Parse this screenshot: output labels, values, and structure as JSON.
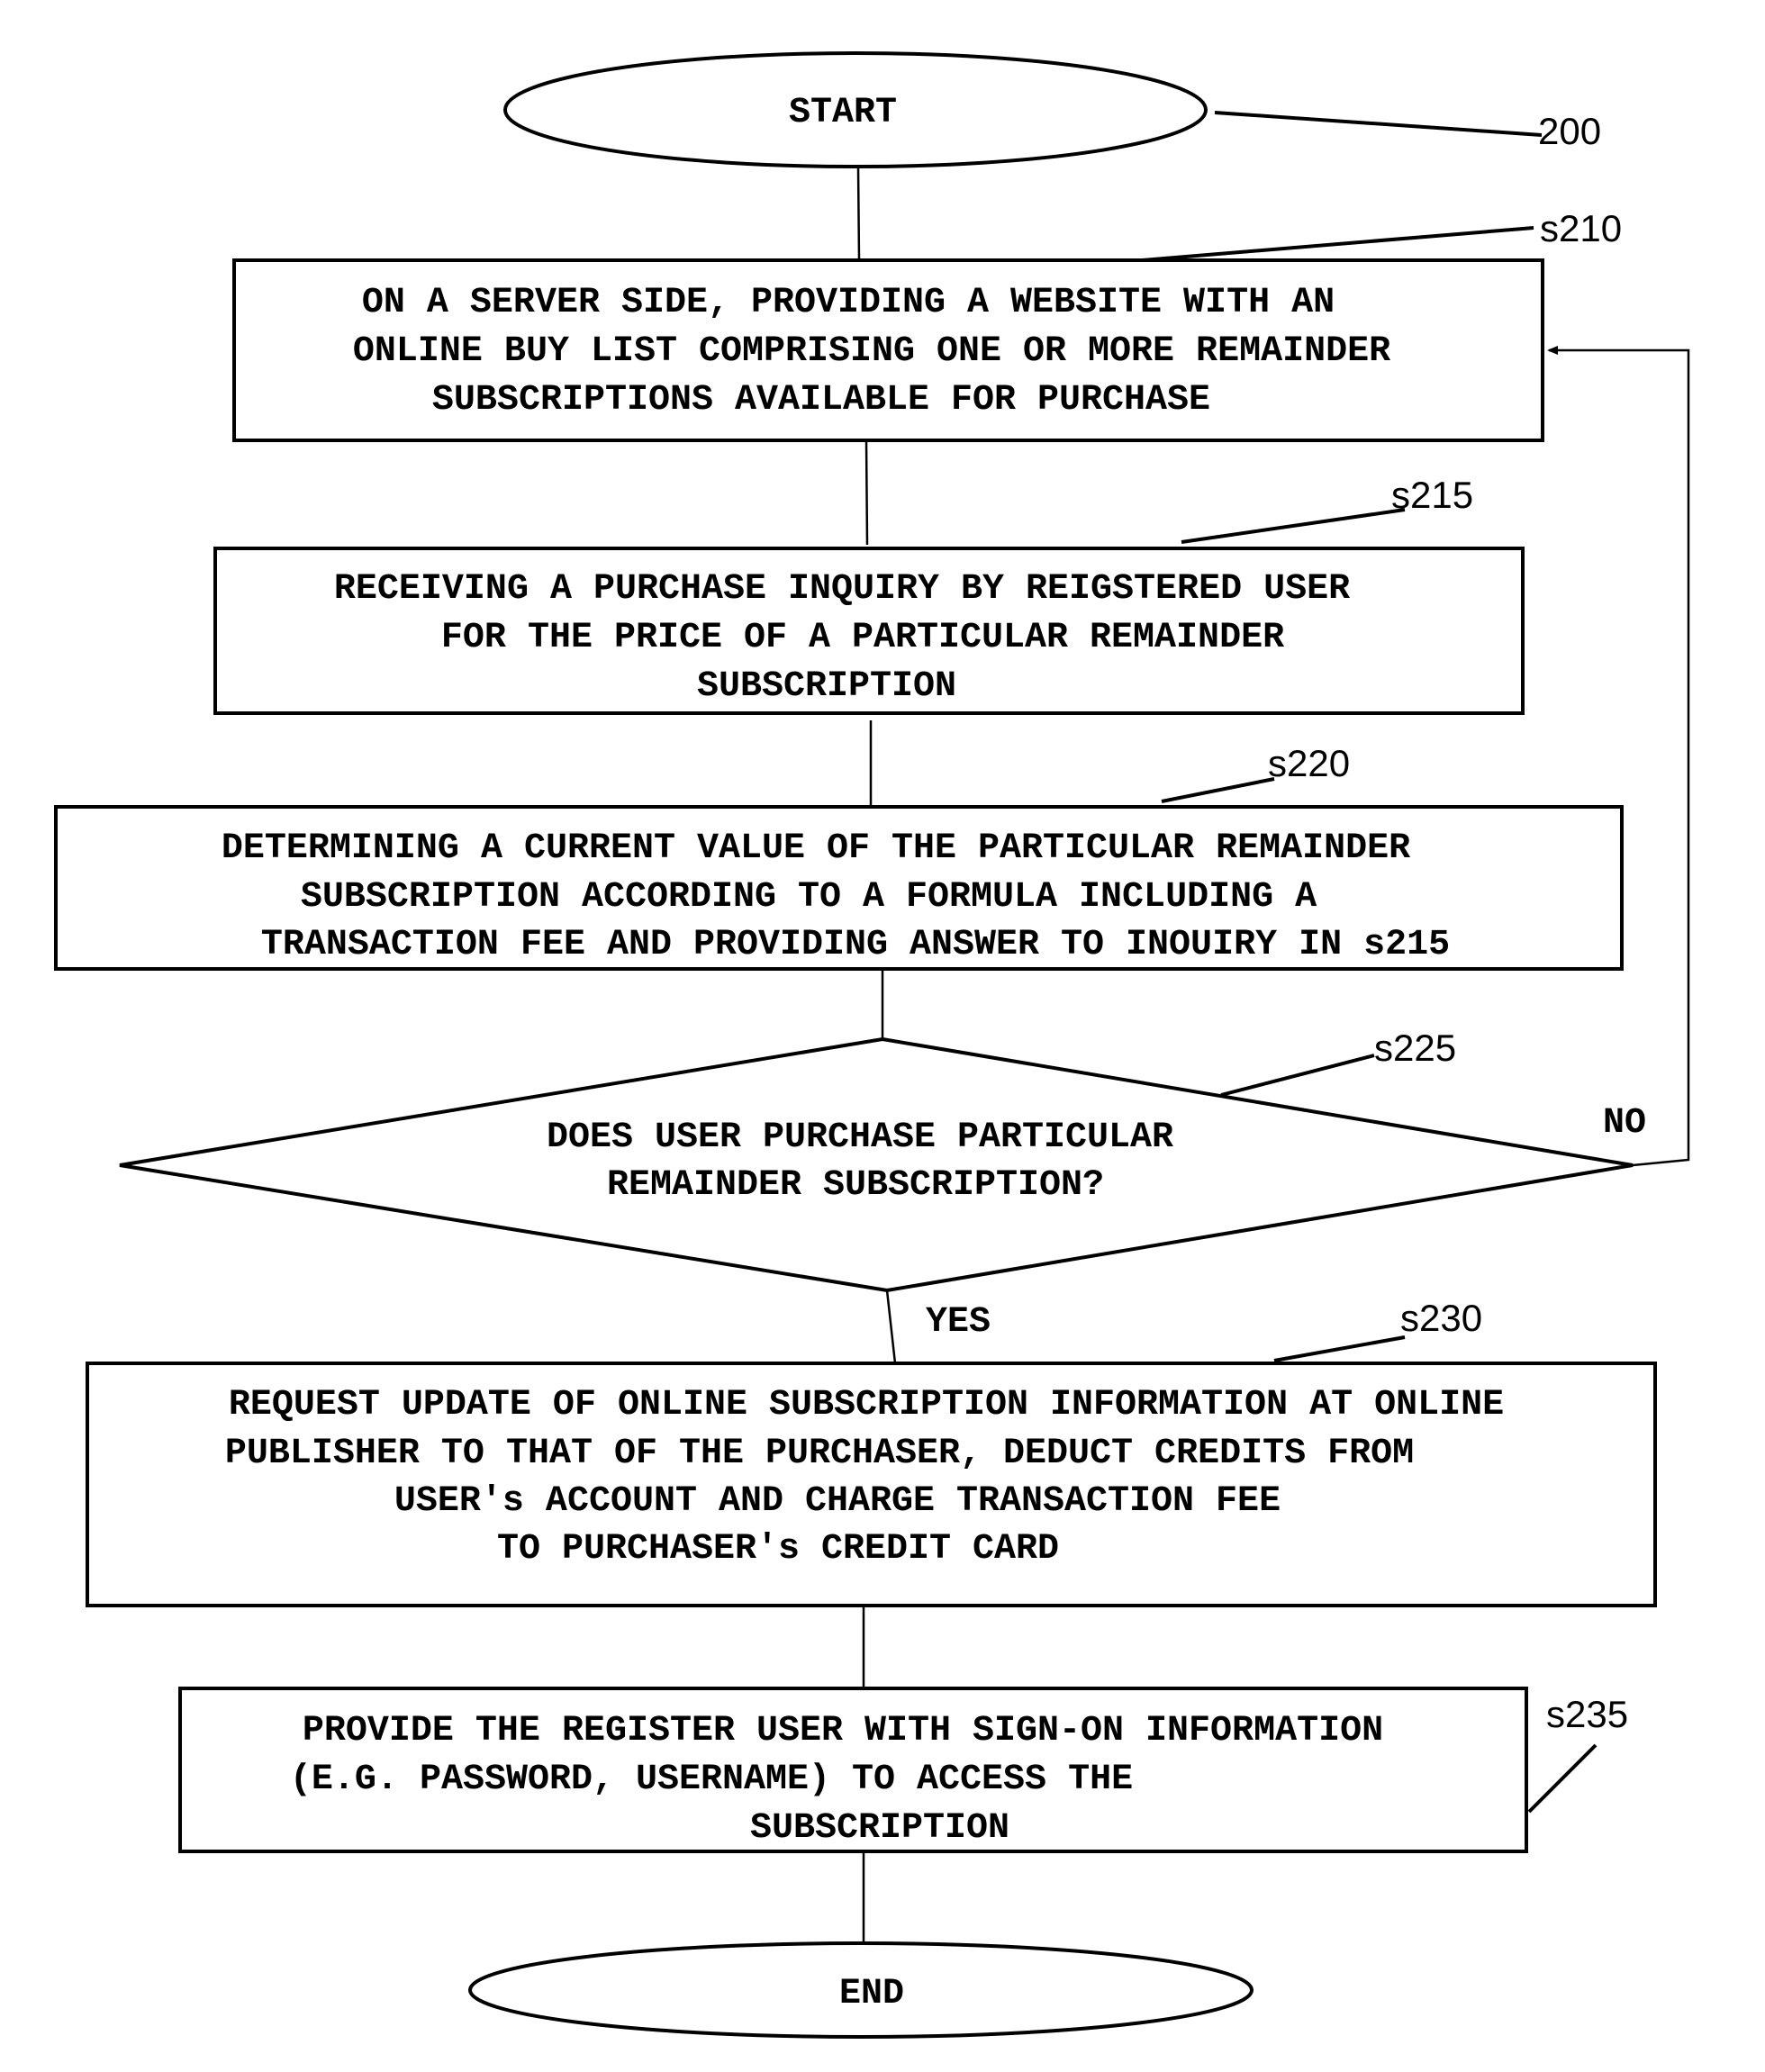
{
  "diagram": {
    "figure_ref": "200",
    "start": {
      "label": "START"
    },
    "end": {
      "label": "END"
    },
    "steps": [
      {
        "ref": "s210",
        "lines": [
          "ON A SERVER SIDE, PROVIDING A WEBSITE WITH AN",
          "ONLINE BUY LIST COMPRISING ONE OR MORE REMAINDER",
          "SUBSCRIPTIONS AVAILABLE FOR PURCHASE"
        ]
      },
      {
        "ref": "s215",
        "lines": [
          "RECEIVING A PURCHASE INQUIRY BY REIGSTERED USER",
          "FOR THE PRICE OF A PARTICULAR REMAINDER",
          "SUBSCRIPTION"
        ]
      },
      {
        "ref": "s220",
        "lines": [
          "DETERMINING A CURRENT VALUE OF THE PARTICULAR REMAINDER",
          "SUBSCRIPTION ACCORDING TO A FORMULA INCLUDING A",
          "TRANSACTION FEE AND PROVIDING ANSWER TO INOUIRY IN s215"
        ]
      },
      {
        "ref": "s225",
        "type": "decision",
        "lines": [
          "DOES USER PURCHASE PARTICULAR",
          "REMAINDER SUBSCRIPTION?"
        ],
        "no_label": "NO",
        "yes_label": "YES"
      },
      {
        "ref": "s230",
        "lines": [
          "REQUEST UPDATE OF ONLINE SUBSCRIPTION INFORMATION AT ONLINE",
          "PUBLISHER TO THAT OF THE PURCHASER, DEDUCT CREDITS FROM",
          "USER's ACCOUNT AND CHARGE TRANSACTION FEE",
          "TO PURCHASER's CREDIT CARD"
        ]
      },
      {
        "ref": "s235",
        "lines": [
          "PROVIDE THE REGISTER USER WITH SIGN-ON INFORMATION",
          "(E.G. PASSWORD, USERNAME) TO ACCESS THE",
          "SUBSCRIPTION"
        ]
      }
    ]
  }
}
